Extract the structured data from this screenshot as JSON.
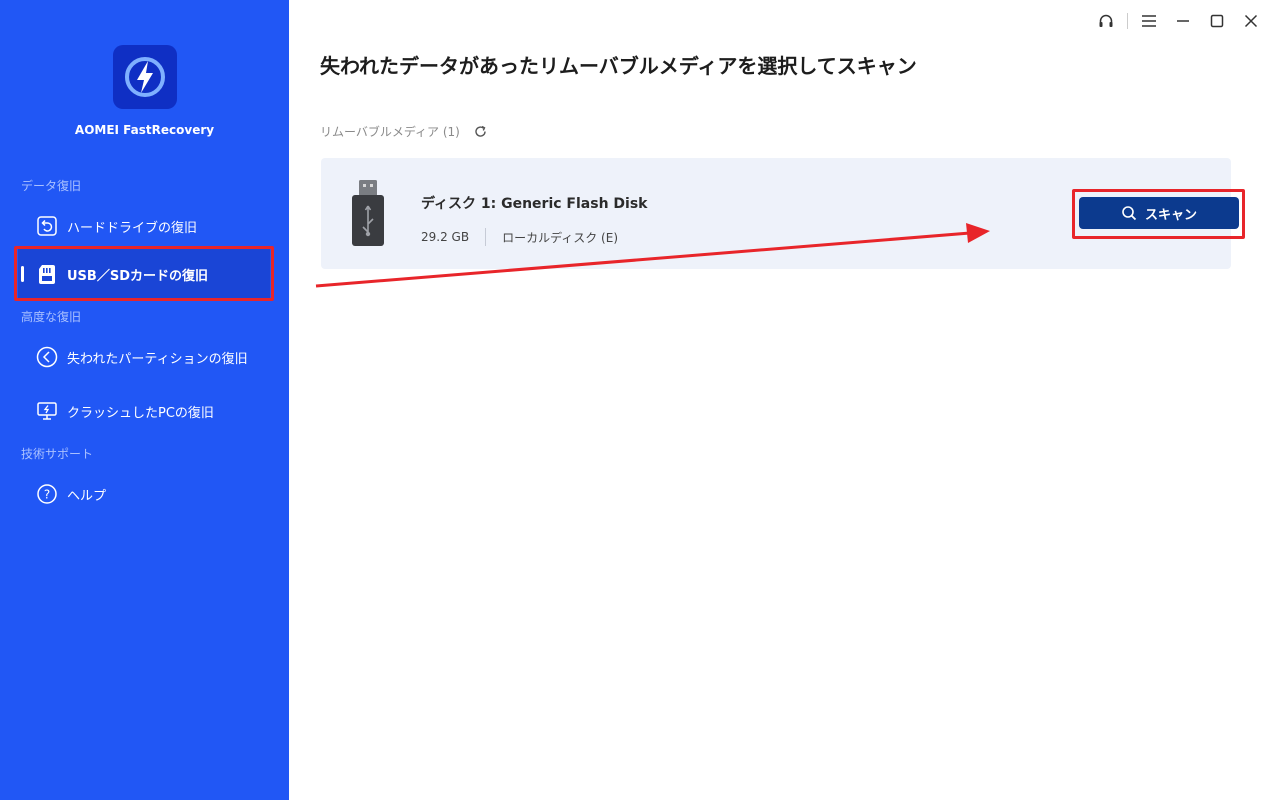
{
  "app": {
    "name": "AOMEI FastRecovery",
    "logo_icon": "lightning-icon",
    "brand_color": "#2157f5",
    "logo_color": "#0f2fc4"
  },
  "sidebar": {
    "sections": [
      {
        "label": "データ復旧",
        "items": [
          {
            "label": "ハードドライブの復旧",
            "icon": "restore-icon",
            "active": false
          },
          {
            "label": "USB／SDカードの復旧",
            "icon": "sd-card-icon",
            "active": true
          }
        ]
      },
      {
        "label": "高度な復旧",
        "items": [
          {
            "label": "失われたパーティションの復旧",
            "icon": "partition-icon",
            "active": false
          },
          {
            "label": "クラッシュしたPCの復旧",
            "icon": "monitor-icon",
            "active": false
          }
        ]
      },
      {
        "label": "技術サポート",
        "items": [
          {
            "label": "ヘルプ",
            "icon": "help-icon",
            "active": false
          }
        ]
      }
    ]
  },
  "window_controls": [
    "headset-icon",
    "menu-icon",
    "minimize-icon",
    "maximize-icon",
    "close-icon"
  ],
  "main": {
    "title": "失われたデータがあったリムーバブルメディアを選択してスキャン",
    "section_header": "リムーバブルメディア (1)",
    "devices": [
      {
        "name": "ディスク 1: Generic  Flash Disk",
        "size": "29.2 GB",
        "type": "ローカルディスク (E)",
        "icon": "usb-drive-icon",
        "scan_label": "スキャン"
      }
    ]
  },
  "colors": {
    "highlight": "#e8252a",
    "scan_button": "#0c3a8e",
    "card_bg": "#eef2fa"
  }
}
